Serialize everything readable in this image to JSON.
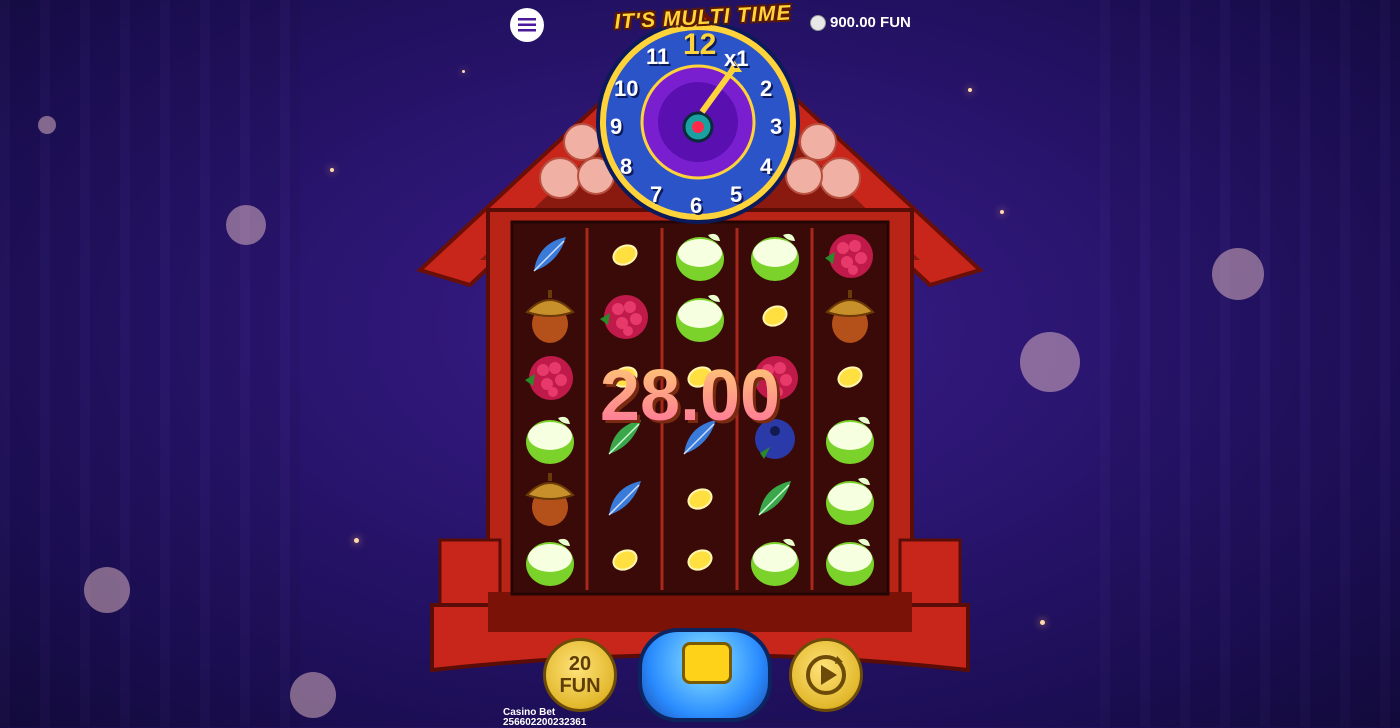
{
  "header": {
    "title": "IT'S MULTI TIME",
    "balance": "900.00 FUN",
    "menu_icon": "hamburger-menu-icon"
  },
  "clock": {
    "numbers": [
      "12",
      "1",
      "2",
      "3",
      "4",
      "5",
      "6",
      "7",
      "8",
      "9",
      "10",
      "11"
    ],
    "multiplier": "x1"
  },
  "reels": [
    [
      "feather-blue",
      "acorn",
      "raspberry",
      "apple",
      "acorn",
      "apple"
    ],
    [
      "coin",
      "raspberry",
      "coin",
      "feather-green",
      "feather-blue",
      "coin"
    ],
    [
      "apple",
      "apple",
      "coin",
      "feather-blue",
      "coin",
      "coin"
    ],
    [
      "apple",
      "coin",
      "raspberry",
      "blueberry",
      "feather-green",
      "apple"
    ],
    [
      "raspberry",
      "acorn",
      "coin",
      "apple",
      "apple",
      "apple"
    ]
  ],
  "win": {
    "amount": "28.00"
  },
  "controls": {
    "bet_value": "20",
    "bet_unit": "FUN",
    "spin_icon": "spin-icon",
    "autoplay_icon": "autoplay-icon"
  },
  "footer": {
    "label": "Casino Bet",
    "round_id": "256602200232361"
  },
  "colors": {
    "wood": "#c8261a",
    "reel_bg": "#3a0a08",
    "accent": "#ffd43a"
  }
}
